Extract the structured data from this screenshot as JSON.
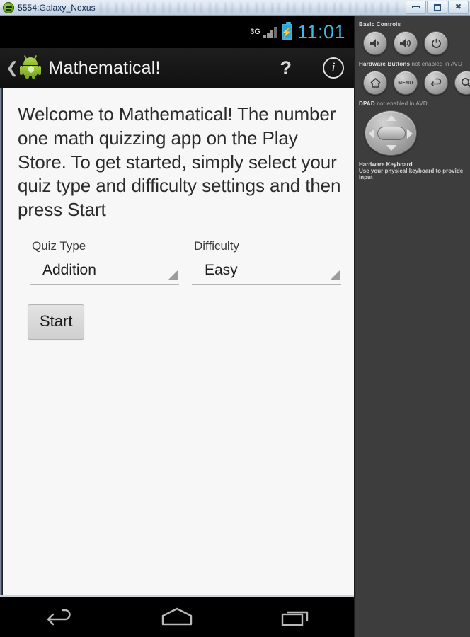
{
  "window": {
    "title": "5554:Galaxy_Nexus",
    "icon": "android-head-icon",
    "controls": {
      "minimize": "minimize-icon",
      "maximize": "maximize-icon",
      "close": "✖"
    }
  },
  "status_bar": {
    "network_type": "3G",
    "signal_icon": "signal-bars-icon",
    "battery_icon": "battery-charging-icon",
    "battery_glyph": "⚡",
    "time": "11:01"
  },
  "action_bar": {
    "back_glyph": "❮",
    "app_icon": "android-robot-icon",
    "title": "Mathematical!",
    "help_label": "?",
    "info_label": "i"
  },
  "main": {
    "welcome_text": "Welcome to Mathematical! The number one math quizzing app on the Play Store. To get started, simply select your quiz type and difficulty settings and then press Start",
    "spinners": [
      {
        "label": "Quiz Type",
        "value": "Addition"
      },
      {
        "label": "Difficulty",
        "value": "Easy"
      }
    ],
    "start_button": "Start"
  },
  "nav_bar": {
    "back": "back-icon",
    "home": "home-icon",
    "recents": "recents-icon"
  },
  "emulator_panel": {
    "basic_controls": {
      "heading": "Basic Controls",
      "buttons": [
        {
          "name": "volume-down-button",
          "glyph": "volume-low-icon"
        },
        {
          "name": "volume-up-button",
          "glyph": "volume-high-icon"
        },
        {
          "name": "power-button",
          "glyph": "power-icon"
        }
      ]
    },
    "hardware_buttons": {
      "heading": "Hardware Buttons",
      "heading_sub": "not enabled in AVD",
      "buttons": [
        {
          "name": "home-button",
          "glyph": "home-icon"
        },
        {
          "name": "menu-button",
          "glyph": "MENU"
        },
        {
          "name": "back-button",
          "glyph": "back-arrow-icon"
        },
        {
          "name": "search-button",
          "glyph": "search-icon"
        }
      ]
    },
    "dpad": {
      "heading": "DPAD",
      "heading_sub": "not enabled in AVD"
    },
    "keyboard": {
      "title": "Hardware Keyboard",
      "subtitle": "Use your physical keyboard to provide input"
    }
  },
  "colors": {
    "accent": "#3fb8e8",
    "panel_bg": "#3d3d3d",
    "screen_bg": "#f7f7f7",
    "android_green": "#8cbb2a"
  }
}
